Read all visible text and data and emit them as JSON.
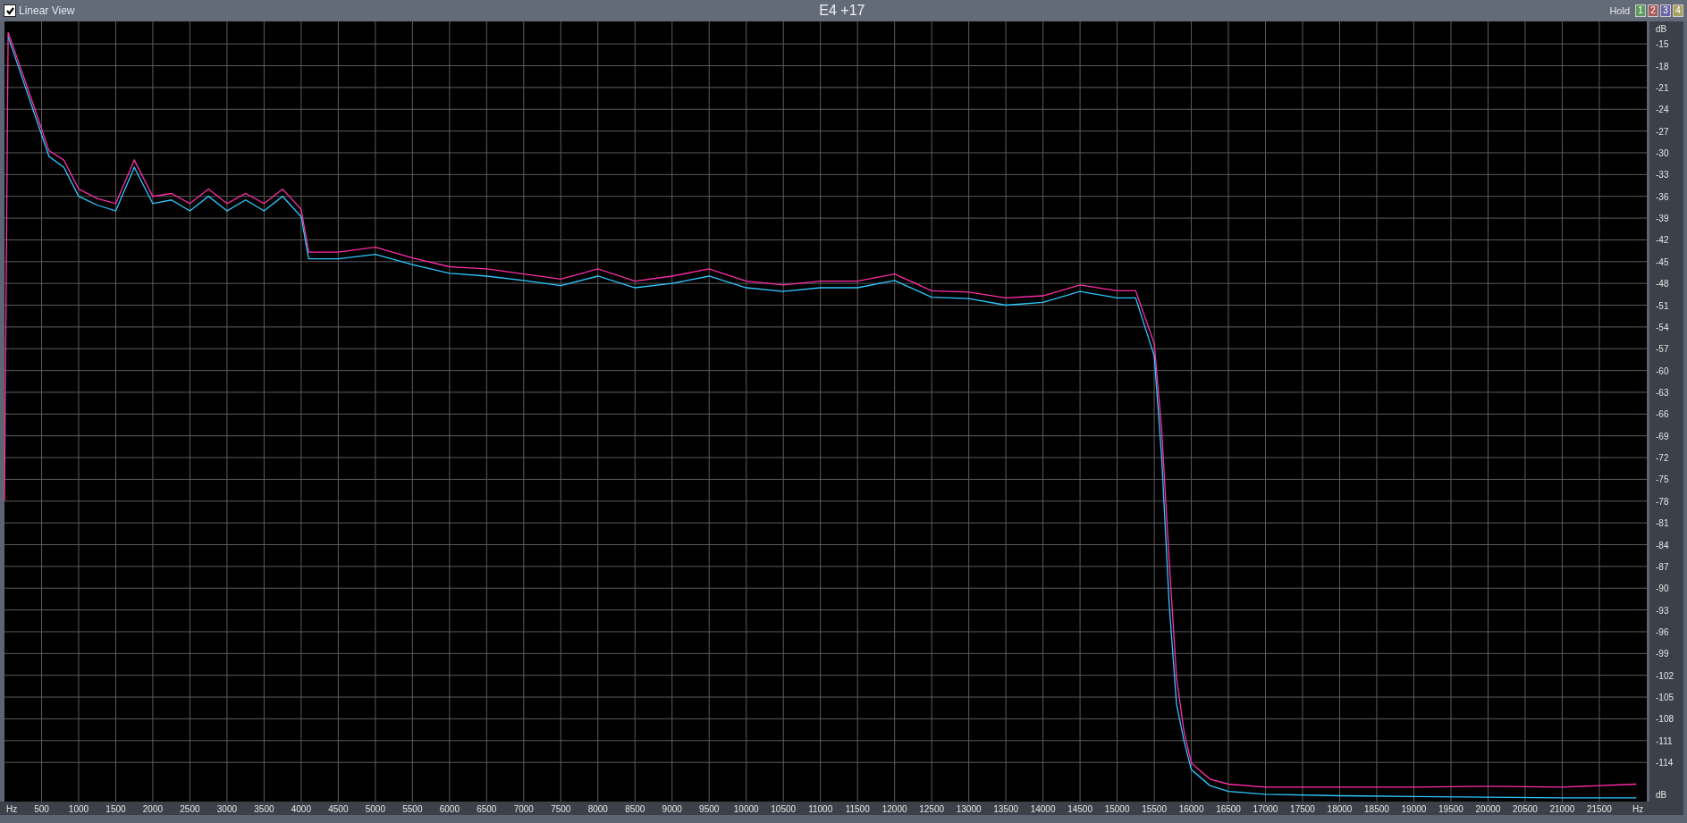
{
  "linear_view": {
    "label": "Linear View",
    "checked": true
  },
  "title": "E4 +17",
  "hold": {
    "label": "Hold",
    "buttons": [
      {
        "label": "1",
        "color": "#5f9a5f"
      },
      {
        "label": "2",
        "color": "#a65a5a"
      },
      {
        "label": "3",
        "color": "#6a64a8"
      },
      {
        "label": "4",
        "color": "#a6a25e"
      }
    ]
  },
  "spectrum": {
    "x_end_label": "Hz",
    "y_end_label": "dB",
    "chart_data": {
      "type": "line",
      "grid": true,
      "xlabel": "Hz",
      "ylabel": "dB",
      "xlim": [
        0,
        22140
      ],
      "ylim": [
        -119.4,
        -11.9
      ],
      "xticks": [
        500,
        1000,
        1500,
        2000,
        2500,
        3000,
        3500,
        4000,
        4500,
        5000,
        5500,
        6000,
        6500,
        7000,
        7500,
        8000,
        8500,
        9000,
        9500,
        10000,
        10500,
        11000,
        11500,
        12000,
        12500,
        13000,
        13500,
        14000,
        14500,
        15000,
        15500,
        16000,
        16500,
        17000,
        17500,
        18000,
        18500,
        19000,
        19500,
        20000,
        20500,
        21000,
        21500
      ],
      "yticks": [
        -15,
        -18,
        -21,
        -24,
        -27,
        -30,
        -33,
        -36,
        -39,
        -42,
        -45,
        -48,
        -51,
        -54,
        -57,
        -60,
        -63,
        -66,
        -69,
        -72,
        -75,
        -78,
        -81,
        -84,
        -87,
        -90,
        -93,
        -96,
        -99,
        -102,
        -105,
        -108,
        -111,
        -114
      ],
      "x": [
        0,
        50,
        200,
        400,
        600,
        800,
        1000,
        1250,
        1500,
        1750,
        2000,
        2250,
        2500,
        2750,
        3000,
        3250,
        3500,
        3750,
        4000,
        4100,
        4500,
        5000,
        5500,
        6000,
        6500,
        7000,
        7500,
        8000,
        8500,
        9000,
        9500,
        10000,
        10500,
        11000,
        11500,
        12000,
        12500,
        13000,
        13500,
        14000,
        14500,
        15000,
        15250,
        15500,
        15600,
        15700,
        15800,
        15900,
        16000,
        16250,
        16500,
        17000,
        18000,
        19000,
        20000,
        21000,
        22000
      ],
      "series": [
        {
          "color": "#ff2ea8",
          "values": [
            -78,
            -13.4,
            -17.8,
            -23.7,
            -29.7,
            -31,
            -35,
            -36.3,
            -37,
            -31,
            -36,
            -35.6,
            -37,
            -35,
            -37,
            -35.6,
            -37,
            -35,
            -37.8,
            -43.7,
            -43.7,
            -43,
            -44.5,
            -45.7,
            -46,
            -46.7,
            -47.4,
            -46,
            -47.7,
            -47,
            -46,
            -47.7,
            -48.2,
            -47.7,
            -47.7,
            -46.7,
            -49,
            -49.2,
            -50,
            -49.7,
            -48.2,
            -49,
            -49,
            -56.3,
            -68.2,
            -86,
            -102.3,
            -109.7,
            -114.1,
            -116.3,
            -117,
            -117.4,
            -117.4,
            -117.4,
            -117.3,
            -117.4,
            -117
          ]
        },
        {
          "color": "#2ec8ff",
          "values": [
            null,
            -14,
            -18.5,
            -24.5,
            -30.5,
            -32,
            -36,
            -37.2,
            -38,
            -32,
            -37,
            -36.5,
            -38,
            -36,
            -38,
            -36.5,
            -38,
            -36,
            -38.8,
            -44.6,
            -44.6,
            -44,
            -45.4,
            -46.6,
            -47,
            -47.6,
            -48.3,
            -47,
            -48.6,
            -48,
            -47,
            -48.6,
            -49.1,
            -48.6,
            -48.6,
            -47.6,
            -49.9,
            -50.1,
            -51,
            -50.6,
            -49.1,
            -50,
            -50,
            -58,
            -72,
            -92,
            -106,
            -111,
            -115,
            -117.2,
            -118,
            -118.4,
            -118.6,
            -118.7,
            -118.8,
            -118.9,
            -118.9
          ]
        }
      ]
    }
  }
}
